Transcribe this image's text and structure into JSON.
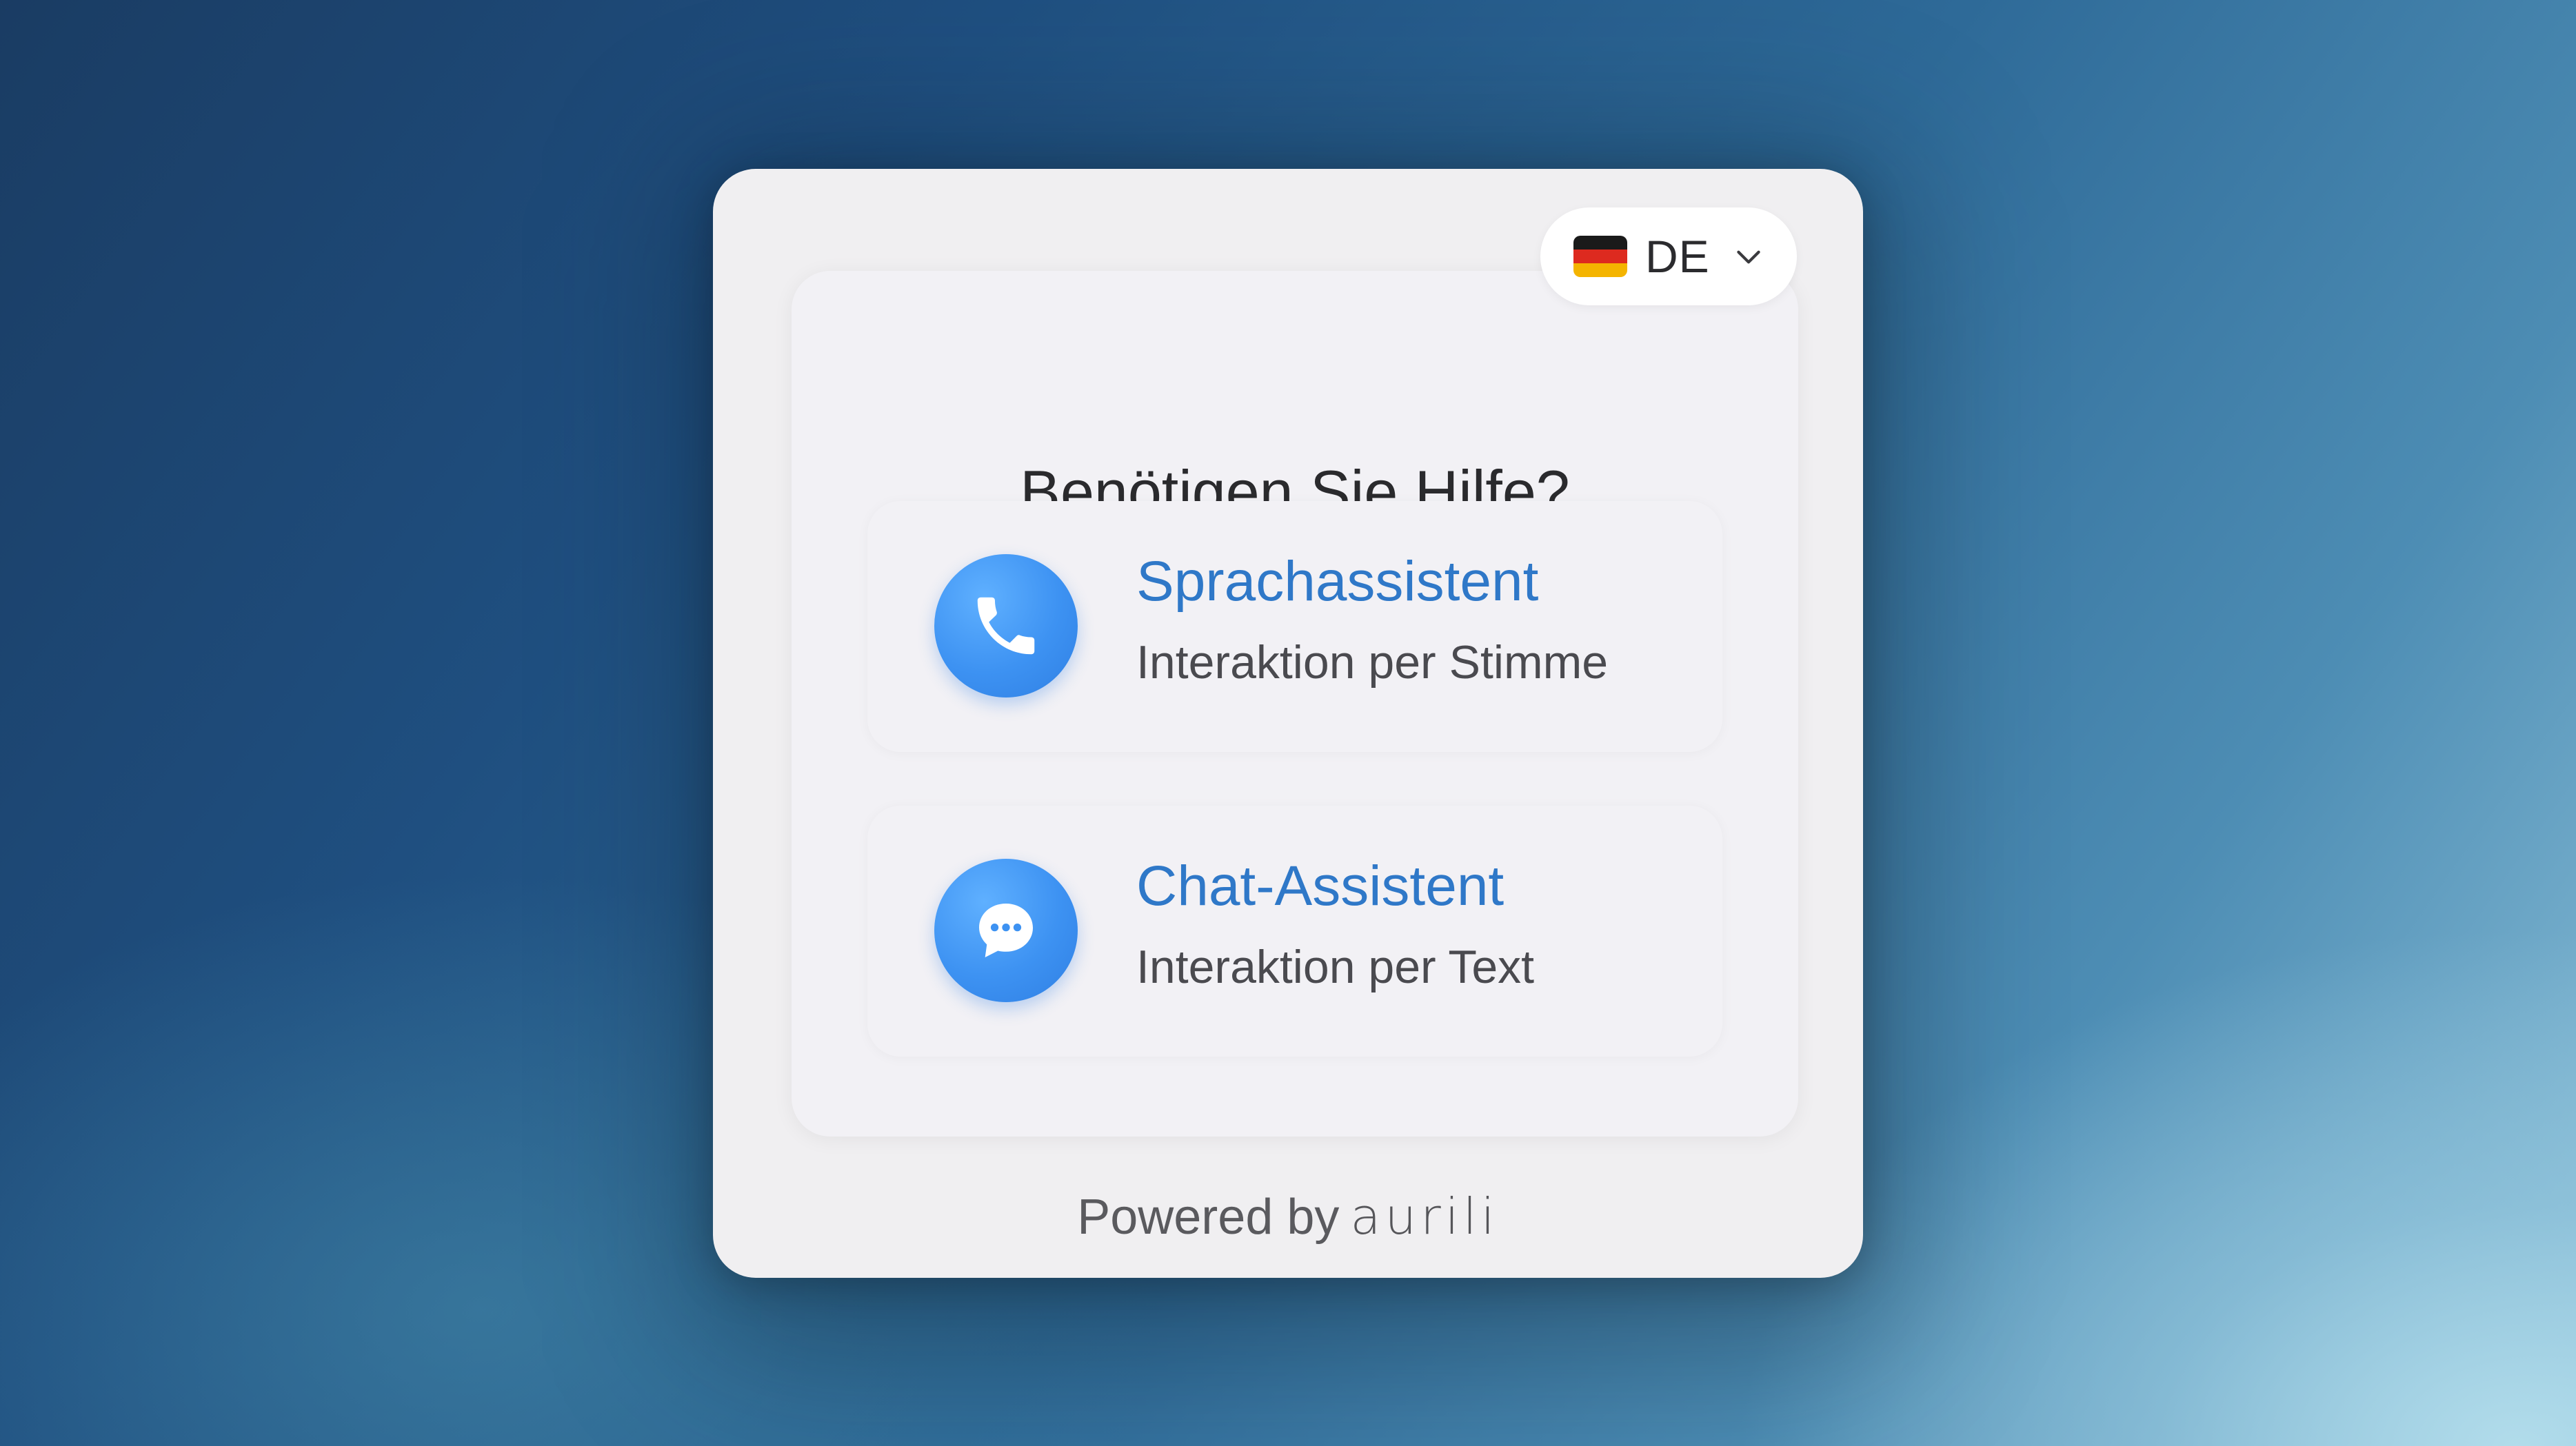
{
  "language": {
    "code": "DE",
    "flag_colors": [
      "#1a1a1a",
      "#dd2a1f",
      "#f4b400"
    ]
  },
  "title": "Benötigen Sie Hilfe?",
  "options": [
    {
      "title": "Sprachassistent",
      "subtitle": "Interaktion per Stimme",
      "icon": "phone-icon"
    },
    {
      "title": "Chat-Assistent",
      "subtitle": "Interaktion per Text",
      "icon": "chat-bubble-icon"
    }
  ],
  "footer": {
    "powered_by": "Powered by",
    "brand": "aurili"
  },
  "colors": {
    "accent": "#2f78c8",
    "icon_bg": "#3d92f2"
  }
}
